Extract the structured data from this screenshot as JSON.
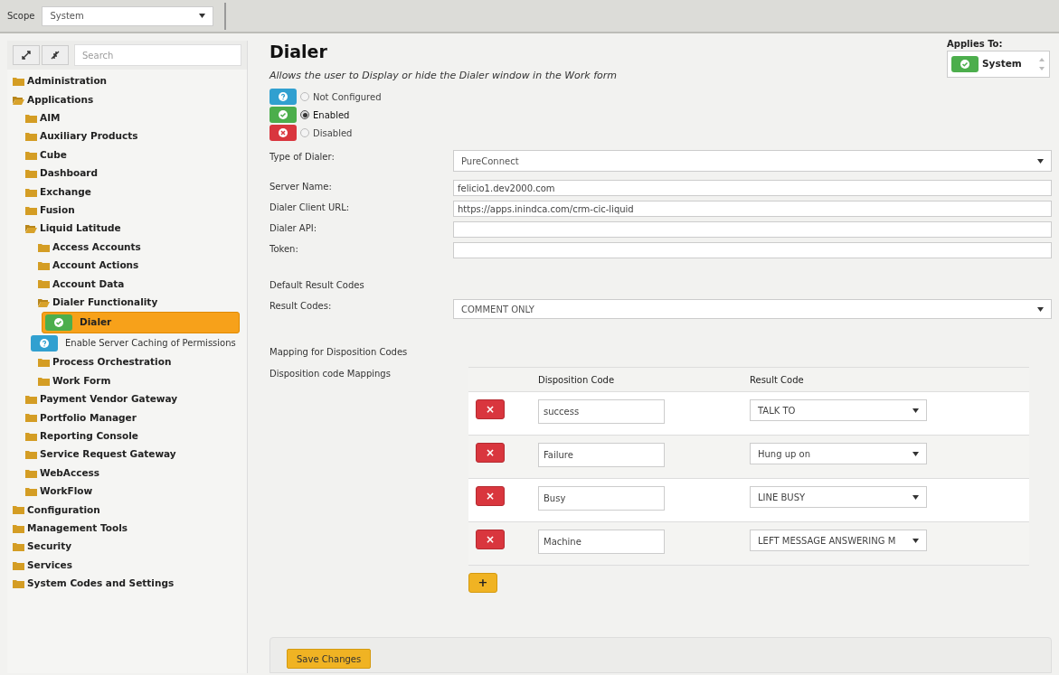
{
  "scope": {
    "label": "Scope",
    "value": "System"
  },
  "sidebar": {
    "search_placeholder": "Search",
    "tree": [
      {
        "label": "Administration",
        "kind": "folder",
        "expanded": false
      },
      {
        "label": "Applications",
        "kind": "folder",
        "expanded": true,
        "children": [
          {
            "label": "AIM",
            "kind": "folder",
            "expanded": false
          },
          {
            "label": "Auxiliary Products",
            "kind": "folder",
            "expanded": false
          },
          {
            "label": "Cube",
            "kind": "folder",
            "expanded": false
          },
          {
            "label": "Dashboard",
            "kind": "folder",
            "expanded": false
          },
          {
            "label": "Exchange",
            "kind": "folder",
            "expanded": false
          },
          {
            "label": "Fusion",
            "kind": "folder",
            "expanded": false
          },
          {
            "label": "Liquid Latitude",
            "kind": "folder",
            "expanded": true,
            "children": [
              {
                "label": "Access Accounts",
                "kind": "folder",
                "expanded": false
              },
              {
                "label": "Account Actions",
                "kind": "folder",
                "expanded": false
              },
              {
                "label": "Account Data",
                "kind": "folder",
                "expanded": false
              },
              {
                "label": "Dialer Functionality",
                "kind": "folder",
                "expanded": true,
                "children": [
                  {
                    "label": "Dialer",
                    "kind": "enabled",
                    "selected": true
                  },
                  {
                    "label": "Enable Server Caching of Permissions",
                    "kind": "not_configured",
                    "selected": false
                  }
                ]
              },
              {
                "label": "Process Orchestration",
                "kind": "folder",
                "expanded": false
              },
              {
                "label": "Work Form",
                "kind": "folder",
                "expanded": false
              }
            ]
          },
          {
            "label": "Payment Vendor Gateway",
            "kind": "folder",
            "expanded": false
          },
          {
            "label": "Portfolio Manager",
            "kind": "folder",
            "expanded": false
          },
          {
            "label": "Reporting Console",
            "kind": "folder",
            "expanded": false
          },
          {
            "label": "Service Request Gateway",
            "kind": "folder",
            "expanded": false
          },
          {
            "label": "WebAccess",
            "kind": "folder",
            "expanded": false
          },
          {
            "label": "WorkFlow",
            "kind": "folder",
            "expanded": false
          }
        ]
      },
      {
        "label": "Configuration",
        "kind": "folder",
        "expanded": false
      },
      {
        "label": "Management Tools",
        "kind": "folder",
        "expanded": false
      },
      {
        "label": "Security",
        "kind": "folder",
        "expanded": false
      },
      {
        "label": "Services",
        "kind": "folder",
        "expanded": false
      },
      {
        "label": "System Codes and Settings",
        "kind": "folder",
        "expanded": false
      }
    ]
  },
  "page": {
    "title": "Dialer",
    "description": "Allows the user to Display or hide the Dialer window in the Work form",
    "applies_to": {
      "label": "Applies To:",
      "items": [
        {
          "label": "System",
          "kind": "enabled"
        }
      ]
    },
    "status_options": [
      {
        "label": "Not Configured",
        "kind": "not_configured",
        "selected": false
      },
      {
        "label": "Enabled",
        "kind": "enabled",
        "selected": true
      },
      {
        "label": "Disabled",
        "kind": "disabled",
        "selected": false
      }
    ],
    "fields": [
      {
        "label": "Type of Dialer:",
        "kind": "dropdown",
        "value": "PureConnect"
      },
      {
        "label": "Server Name:",
        "kind": "text",
        "value": "felicio1.dev2000.com"
      },
      {
        "label": "Dialer Client URL:",
        "kind": "text",
        "value": "https://apps.inindca.com/crm-cic-liquid"
      },
      {
        "label": "Dialer API:",
        "kind": "text"
      },
      {
        "label": "Token:",
        "kind": "text"
      }
    ],
    "default_section": "Default Result Codes",
    "result_codes": {
      "label": "Result Codes:",
      "value": "COMMENT ONLY"
    },
    "mapping_section": "Mapping for Disposition Codes",
    "mappings": {
      "label": "Disposition code Mappings",
      "columns": [
        "Disposition Code",
        "Result Code"
      ],
      "rows": [
        {
          "disposition": "success",
          "result": "TALK TO"
        },
        {
          "disposition": "Failure",
          "result": "Hung up on"
        },
        {
          "disposition": "Busy",
          "result": "LINE BUSY"
        },
        {
          "disposition": "Machine",
          "result": "LEFT MESSAGE ANSWERING M"
        }
      ],
      "add_button": "+",
      "remove_button": "×"
    },
    "save_button": "Save Changes"
  }
}
